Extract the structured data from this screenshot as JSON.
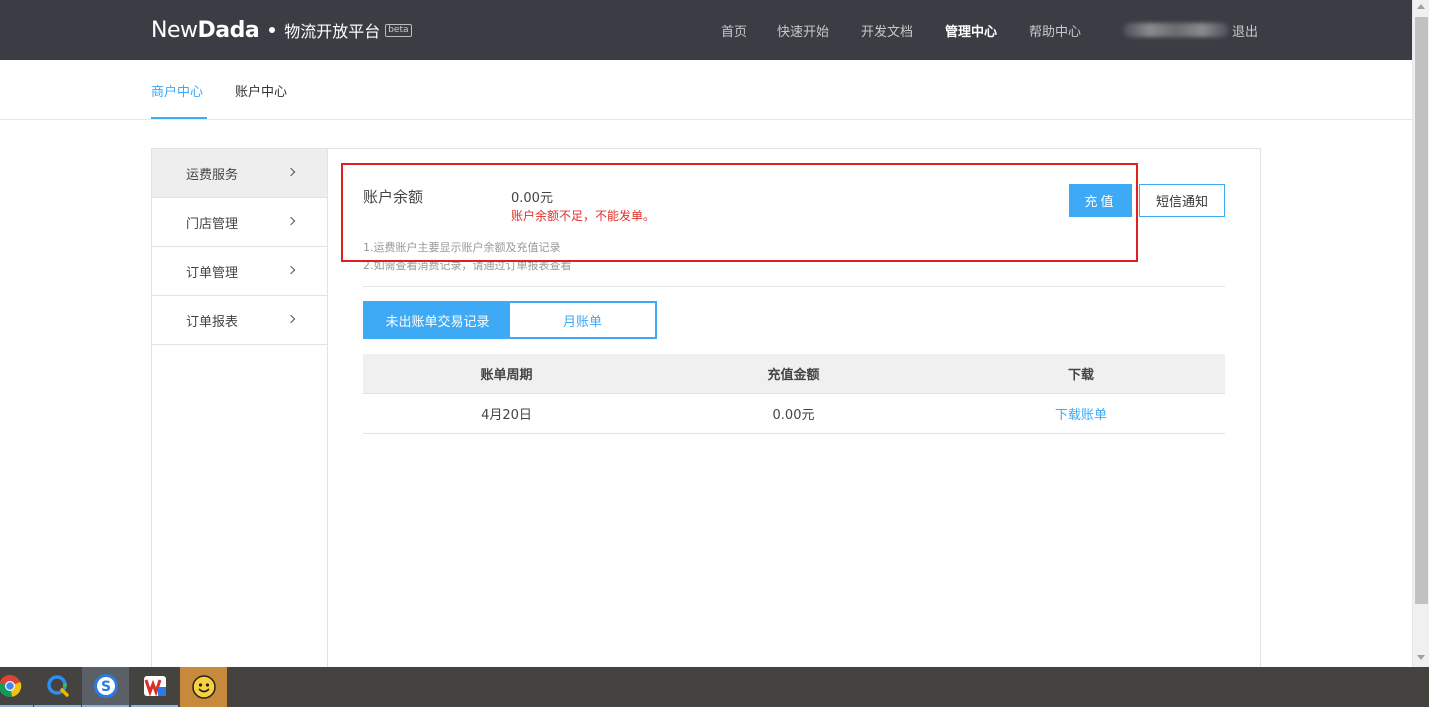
{
  "header": {
    "logo_new": "New",
    "logo_dada": "Dada",
    "logo_subtitle": "物流开放平台",
    "logo_badge": "beta",
    "nav": [
      {
        "label": "首页"
      },
      {
        "label": "快速开始"
      },
      {
        "label": "开发文档"
      },
      {
        "label": "管理中心"
      },
      {
        "label": "帮助中心"
      }
    ],
    "logout_label": "退出"
  },
  "subnav": {
    "tabs": [
      {
        "label": "商户中心"
      },
      {
        "label": "账户中心"
      }
    ]
  },
  "sidebar": {
    "items": [
      {
        "label": "运费服务"
      },
      {
        "label": "门店管理"
      },
      {
        "label": "订单管理"
      },
      {
        "label": "订单报表"
      }
    ]
  },
  "balance": {
    "label": "账户余额",
    "value": "0.00元",
    "warning": "账户余额不足，不能发单。",
    "notes": [
      "1.运费账户主要显示账户余额及充值记录",
      "2.如需查看消费记录，请通过订单报表查看"
    ],
    "recharge_label": "充值",
    "sms_label": "短信通知"
  },
  "records": {
    "tabs": [
      {
        "label": "未出账单交易记录"
      },
      {
        "label": "月账单"
      }
    ],
    "columns": [
      "账单周期",
      "充值金额",
      "下载"
    ],
    "rows": [
      {
        "period": "4月20日",
        "amount": "0.00元",
        "download": "下载账单"
      }
    ]
  },
  "taskbar": {
    "apps": [
      {
        "icon": "chrome-icon"
      },
      {
        "icon": "qq-browser-icon"
      },
      {
        "icon": "sogou-icon"
      },
      {
        "icon": "wps-icon"
      },
      {
        "icon": "qq-icon"
      }
    ]
  },
  "colors": {
    "accent": "#3ea9f5",
    "header_bg": "#3a3d44",
    "warning": "#e0312b",
    "highlight_box": "#e02020"
  }
}
